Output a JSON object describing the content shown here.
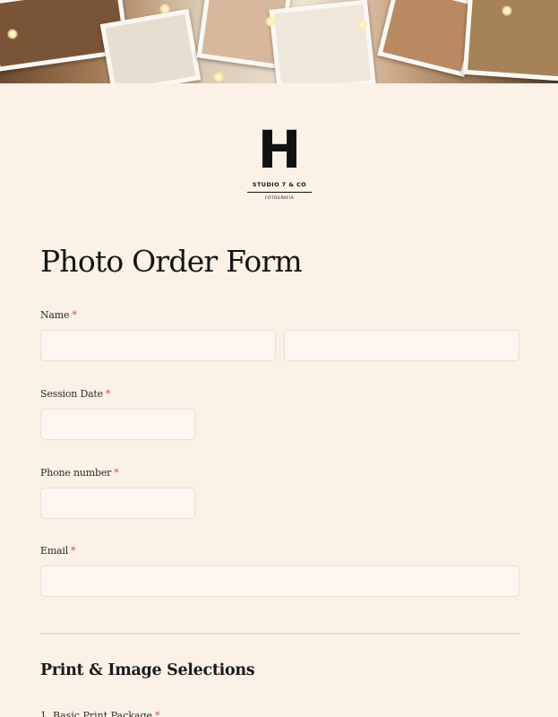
{
  "logo": {
    "letter": "H",
    "name": "STUDIO 7 & CO",
    "sub": "FOTOGRAFIA"
  },
  "form": {
    "title": "Photo Order Form",
    "required_marker": "*",
    "fields": {
      "name": {
        "label": "Name",
        "first_value": "",
        "last_value": ""
      },
      "session_date": {
        "label": "Session Date",
        "value": ""
      },
      "phone": {
        "label": "Phone number",
        "value": ""
      },
      "email": {
        "label": "Email",
        "value": ""
      }
    },
    "section": {
      "title": "Print & Image Selections",
      "first_item_label": "1. Basic Print Package"
    }
  },
  "colors": {
    "background": "#fcf1e7",
    "field_bg": "#fdf6f1",
    "required": "#d64545"
  }
}
